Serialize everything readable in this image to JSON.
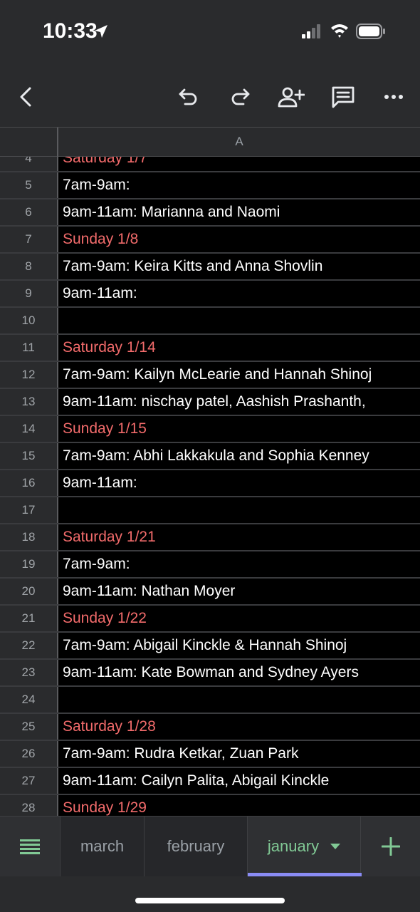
{
  "status_bar": {
    "time": "10:33",
    "icons": [
      "location-icon",
      "signal-icon",
      "wifi-icon",
      "battery-icon"
    ]
  },
  "toolbar": {
    "icons": [
      "back-icon",
      "undo-icon",
      "redo-icon",
      "share-icon",
      "comment-icon",
      "more-icon"
    ]
  },
  "sheet": {
    "column_header": "A",
    "rows": [
      {
        "num": "4",
        "text": "Saturday 1/7",
        "day": true
      },
      {
        "num": "5",
        "text": "7am-9am:",
        "day": false
      },
      {
        "num": "6",
        "text": "9am-11am: Marianna and Naomi",
        "day": false
      },
      {
        "num": "7",
        "text": "Sunday 1/8",
        "day": true
      },
      {
        "num": "8",
        "text": "7am-9am: Keira Kitts and Anna Shovlin",
        "day": false
      },
      {
        "num": "9",
        "text": "9am-11am:",
        "day": false
      },
      {
        "num": "10",
        "text": "",
        "day": false
      },
      {
        "num": "11",
        "text": "Saturday 1/14",
        "day": true
      },
      {
        "num": "12",
        "text": "7am-9am: Kailyn McLearie and Hannah Shinoj",
        "day": false
      },
      {
        "num": "13",
        "text": "9am-11am: nischay patel, Aashish Prashanth,",
        "day": false
      },
      {
        "num": "14",
        "text": "Sunday 1/15",
        "day": true
      },
      {
        "num": "15",
        "text": "7am-9am: Abhi Lakkakula and Sophia Kenney",
        "day": false
      },
      {
        "num": "16",
        "text": "9am-11am:",
        "day": false
      },
      {
        "num": "17",
        "text": "",
        "day": false
      },
      {
        "num": "18",
        "text": "Saturday 1/21",
        "day": true
      },
      {
        "num": "19",
        "text": "7am-9am:",
        "day": false
      },
      {
        "num": "20",
        "text": "9am-11am: Nathan Moyer",
        "day": false
      },
      {
        "num": "21",
        "text": "Sunday 1/22",
        "day": true
      },
      {
        "num": "22",
        "text": "7am-9am: Abigail Kinckle & Hannah Shinoj",
        "day": false
      },
      {
        "num": "23",
        "text": "9am-11am: Kate Bowman and Sydney Ayers",
        "day": false
      },
      {
        "num": "24",
        "text": "",
        "day": false
      },
      {
        "num": "25",
        "text": "Saturday 1/28",
        "day": true
      },
      {
        "num": "26",
        "text": "7am-9am: Rudra Ketkar, Zuan Park",
        "day": false
      },
      {
        "num": "27",
        "text": "9am-11am: Cailyn Palita, Abigail Kinckle",
        "day": false
      },
      {
        "num": "28",
        "text": "Sunday 1/29",
        "day": true
      }
    ]
  },
  "tabs": {
    "items": [
      "march",
      "february",
      "january"
    ],
    "active": "january"
  },
  "colors": {
    "day_heading": "#f26b6b",
    "active_tab_text": "#81c995",
    "active_tab_underline": "#8a8cf5",
    "add_sheet": "#81c995"
  }
}
